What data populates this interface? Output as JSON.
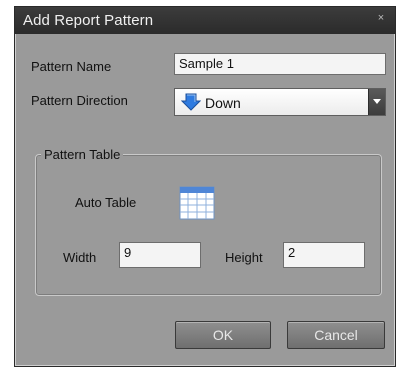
{
  "dialog": {
    "title": "Add Report Pattern",
    "close_glyph": "×"
  },
  "form": {
    "pattern_name_label": "Pattern Name",
    "pattern_name_value": "Sample 1",
    "pattern_direction_label": "Pattern Direction",
    "pattern_direction_value": "Down",
    "pattern_direction_icon": "down-arrow-icon"
  },
  "pattern_table": {
    "legend": "Pattern Table",
    "auto_table_label": "Auto Table",
    "auto_table_icon": "table-grid-icon",
    "width_label": "Width",
    "width_value": "9",
    "height_label": "Height",
    "height_value": "2"
  },
  "buttons": {
    "ok_label": "OK",
    "cancel_label": "Cancel"
  },
  "colors": {
    "dialog_bg": "#9a9a9a",
    "titlebar_bg": "#2b2b2b",
    "direction_icon": "#2f7be0"
  }
}
